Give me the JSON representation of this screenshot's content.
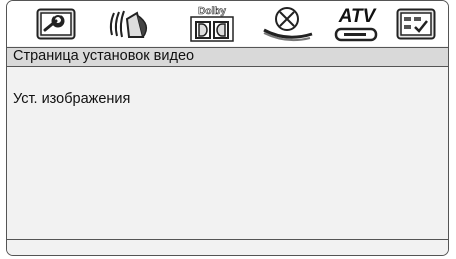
{
  "tabs": [
    {
      "id": "general",
      "icon": "wrench-panel-icon"
    },
    {
      "id": "audio",
      "icon": "speaker-icon"
    },
    {
      "id": "dolby",
      "icon": "dolby-icon",
      "label": "Dolby"
    },
    {
      "id": "video",
      "icon": "video-icon"
    },
    {
      "id": "atv",
      "icon": "tv-icon",
      "label": "ATV"
    },
    {
      "id": "preference",
      "icon": "preferences-panel-icon"
    }
  ],
  "header": {
    "title": "Страница установок видео"
  },
  "menu": {
    "items": [
      {
        "label": "Уст. изображения"
      }
    ]
  }
}
